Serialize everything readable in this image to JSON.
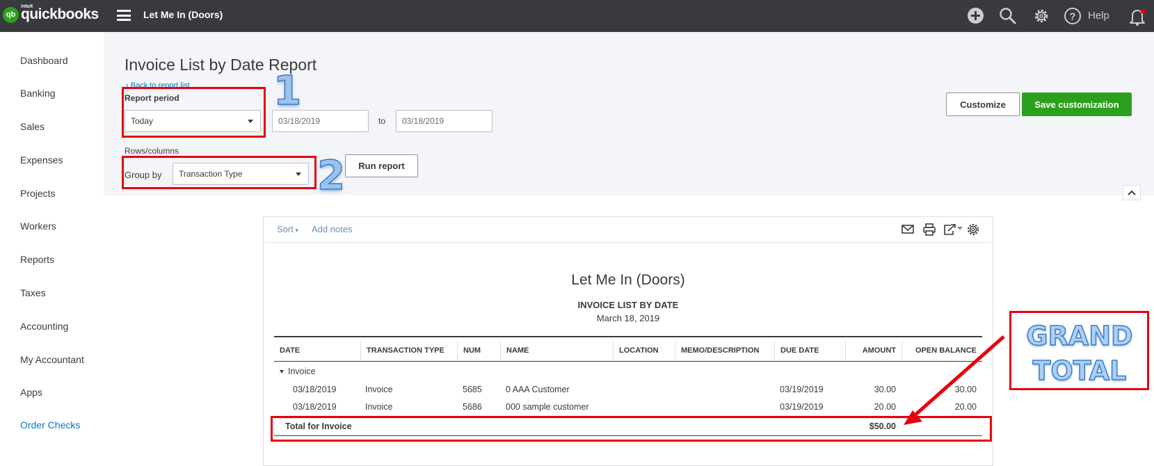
{
  "app": {
    "brand": "quickbooks",
    "brand_prefix": "intuit",
    "company_name": "Let Me In (Doors)",
    "help_label": "Help",
    "accent_color": "#2ca01c"
  },
  "topbar_icons": [
    "plus-icon",
    "search-icon",
    "gear-icon",
    "help-icon",
    "bell-icon"
  ],
  "sidebar": {
    "items": [
      {
        "label": "Dashboard"
      },
      {
        "label": "Banking"
      },
      {
        "label": "Sales"
      },
      {
        "label": "Expenses"
      },
      {
        "label": "Projects"
      },
      {
        "label": "Workers"
      },
      {
        "label": "Reports"
      },
      {
        "label": "Taxes"
      },
      {
        "label": "Accounting"
      },
      {
        "label": "My Accountant"
      },
      {
        "label": "Apps"
      },
      {
        "label": "Order Checks"
      }
    ]
  },
  "header": {
    "title": "Invoice List by Date Report",
    "back_link": "Back to report list"
  },
  "filters": {
    "report_period_label": "Report period",
    "report_period_value": "Today",
    "date_from": "03/18/2019",
    "to_label": "to",
    "date_to": "03/18/2019",
    "rows_columns_label": "Rows/columns",
    "group_by_label": "Group by",
    "group_by_value": "Transaction Type",
    "run_report_label": "Run report",
    "customize_label": "Customize",
    "save_customization_label": "Save customization"
  },
  "report_toolbar": {
    "sort_label": "Sort",
    "add_notes_label": "Add notes",
    "icons": [
      "email-icon",
      "print-icon",
      "export-icon",
      "settings-icon"
    ]
  },
  "report": {
    "company": "Let Me In (Doors)",
    "title": "INVOICE LIST BY DATE",
    "date": "March 18, 2019",
    "columns": [
      "DATE",
      "TRANSACTION TYPE",
      "NUM",
      "NAME",
      "LOCATION",
      "MEMO/DESCRIPTION",
      "DUE DATE",
      "AMOUNT",
      "OPEN BALANCE"
    ],
    "group_label": "Invoice",
    "rows": [
      {
        "date": "03/18/2019",
        "type": "Invoice",
        "num": "5685",
        "name": "0 AAA Customer",
        "location": "",
        "memo": "",
        "due": "03/19/2019",
        "amount": "30.00",
        "open": "30.00"
      },
      {
        "date": "03/18/2019",
        "type": "Invoice",
        "num": "5686",
        "name": "000 sample customer",
        "location": "",
        "memo": "",
        "due": "03/19/2019",
        "amount": "20.00",
        "open": "20.00"
      }
    ],
    "total_label": "Total for Invoice",
    "total_amount": "$50.00"
  },
  "annotations": {
    "callout_1": "1",
    "callout_2": "2",
    "grand_total_line1": "GRAND",
    "grand_total_line2": "TOTAL",
    "highlight_color": "#e8000b"
  }
}
